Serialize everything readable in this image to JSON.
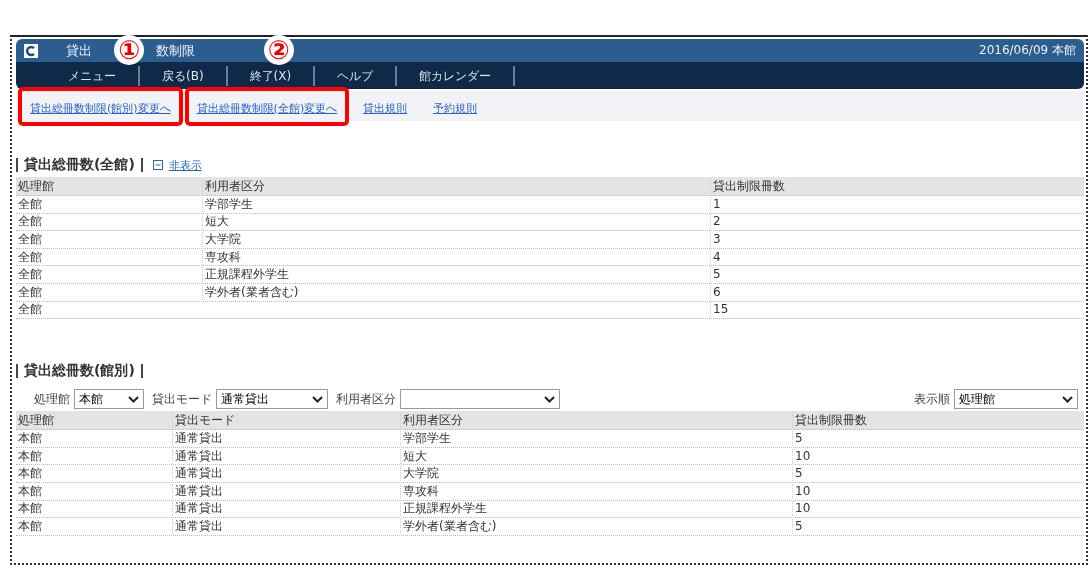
{
  "window": {
    "title": "貸出",
    "title_tail": "数制限",
    "date_location": "2016/06/09 本館"
  },
  "menu": [
    {
      "label": "メニュー"
    },
    {
      "label": "戻る(B)"
    },
    {
      "label": "終了(X)"
    },
    {
      "label": "ヘルプ"
    },
    {
      "label": "館カレンダー"
    }
  ],
  "links": [
    {
      "label": "貸出総冊数制限(館別)変更へ",
      "highlighted": true,
      "callout": "①"
    },
    {
      "label": "貸出総冊数制限(全館)変更へ",
      "highlighted": true,
      "callout": "②"
    },
    {
      "label": "貸出規則",
      "highlighted": false
    },
    {
      "label": "予約規則",
      "highlighted": false
    }
  ],
  "section_all": {
    "title": "貸出総冊数(全館)",
    "toggle": "非表示",
    "columns": [
      "処理館",
      "利用者区分",
      "貸出制限冊数"
    ],
    "rows": [
      [
        "全館",
        "学部学生",
        "1"
      ],
      [
        "全館",
        "短大",
        "2"
      ],
      [
        "全館",
        "大学院",
        "3"
      ],
      [
        "全館",
        "専攻科",
        "4"
      ],
      [
        "全館",
        "正規課程外学生",
        "5"
      ],
      [
        "全館",
        "学外者(業者含む)",
        "6"
      ],
      [
        "全館",
        "",
        "15"
      ]
    ]
  },
  "section_branch": {
    "title": "貸出総冊数(館別)",
    "filters": [
      {
        "label": "処理館",
        "value": "本館"
      },
      {
        "label": "貸出モード",
        "value": "通常貸出"
      },
      {
        "label": "利用者区分"
      }
    ],
    "sort": {
      "label": "表示順",
      "value": "処理館"
    },
    "columns": [
      "処理館",
      "貸出モード",
      "利用者区分",
      "貸出制限冊数"
    ],
    "rows": [
      [
        "本館",
        "通常貸出",
        "学部学生",
        "5"
      ],
      [
        "本館",
        "通常貸出",
        "短大",
        "10"
      ],
      [
        "本館",
        "通常貸出",
        "大学院",
        "5"
      ],
      [
        "本館",
        "通常貸出",
        "専攻科",
        "10"
      ],
      [
        "本館",
        "通常貸出",
        "正規課程外学生",
        "10"
      ],
      [
        "本館",
        "通常貸出",
        "学外者(業者含む)",
        "5"
      ]
    ]
  }
}
